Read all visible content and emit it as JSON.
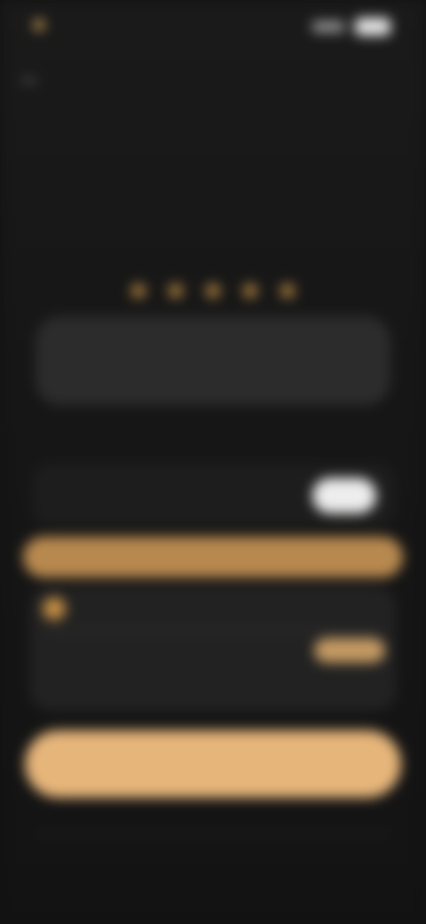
{
  "status_bar": {
    "time": "",
    "icons": [
      "signal-icon",
      "battery-icon"
    ]
  },
  "nav": {
    "back_icon": "back-arrow-icon"
  },
  "paywall": {
    "title": "",
    "rating": 5,
    "testimonial": "",
    "testimonial_author": "",
    "plan_toggle_label": "",
    "offer_banner": "",
    "option": {
      "title": "",
      "price_right": "",
      "badge": "",
      "subtitle": "",
      "note": ""
    },
    "cta_label": "",
    "footer_links": ""
  },
  "colors": {
    "accent": "#e6b57a",
    "banner": "#b8894f",
    "star": "#d49a4a",
    "background": "#161616"
  }
}
